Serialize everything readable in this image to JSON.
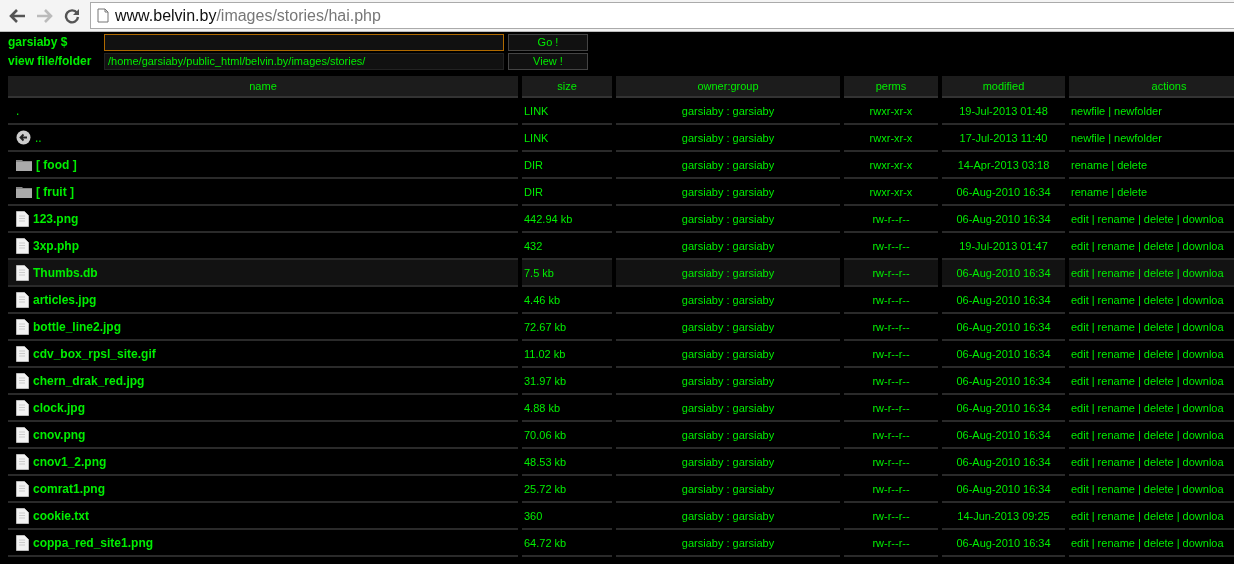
{
  "browser": {
    "url_host": "www.belvin.by",
    "url_path": "/images/stories/hai.php"
  },
  "command": {
    "label": "garsiaby $",
    "button": "Go !"
  },
  "view": {
    "label": "view file/folder",
    "value": "/home/garsiaby/public_html/belvin.by/images/stories/",
    "button": "View !"
  },
  "table": {
    "columns": [
      "name",
      "size",
      "owner:group",
      "perms",
      "modified",
      "actions"
    ],
    "separator": "|",
    "rows": [
      {
        "kind": "link",
        "name": ".",
        "size": "LINK",
        "owner": "garsiaby : garsiaby",
        "perms": "rwxr-xr-x",
        "modified": "19-Jul-2013 01:48",
        "actions": [
          "newfile",
          "newfolder"
        ],
        "selected": false
      },
      {
        "kind": "up",
        "name": "..",
        "size": "LINK",
        "owner": "garsiaby : garsiaby",
        "perms": "rwxr-xr-x",
        "modified": "17-Jul-2013 11:40",
        "actions": [
          "newfile",
          "newfolder"
        ],
        "selected": false
      },
      {
        "kind": "dir",
        "name": "[ food ]",
        "size": "DIR",
        "owner": "garsiaby : garsiaby",
        "perms": "rwxr-xr-x",
        "modified": "14-Apr-2013 03:18",
        "actions": [
          "rename",
          "delete"
        ],
        "selected": false
      },
      {
        "kind": "dir",
        "name": "[ fruit ]",
        "size": "DIR",
        "owner": "garsiaby : garsiaby",
        "perms": "rwxr-xr-x",
        "modified": "06-Aug-2010 16:34",
        "actions": [
          "rename",
          "delete"
        ],
        "selected": false
      },
      {
        "kind": "file",
        "name": "123.png",
        "size": "442.94 kb",
        "owner": "garsiaby : garsiaby",
        "perms": "rw-r--r--",
        "modified": "06-Aug-2010 16:34",
        "actions": [
          "edit",
          "rename",
          "delete",
          "downloa"
        ],
        "selected": false
      },
      {
        "kind": "file",
        "name": "3xp.php",
        "size": "432",
        "owner": "garsiaby : garsiaby",
        "perms": "rw-r--r--",
        "modified": "19-Jul-2013 01:47",
        "actions": [
          "edit",
          "rename",
          "delete",
          "downloa"
        ],
        "selected": false
      },
      {
        "kind": "file",
        "name": "Thumbs.db",
        "size": "7.5 kb",
        "owner": "garsiaby : garsiaby",
        "perms": "rw-r--r--",
        "modified": "06-Aug-2010 16:34",
        "actions": [
          "edit",
          "rename",
          "delete",
          "downloa"
        ],
        "selected": true
      },
      {
        "kind": "file",
        "name": "articles.jpg",
        "size": "4.46 kb",
        "owner": "garsiaby : garsiaby",
        "perms": "rw-r--r--",
        "modified": "06-Aug-2010 16:34",
        "actions": [
          "edit",
          "rename",
          "delete",
          "downloa"
        ],
        "selected": false
      },
      {
        "kind": "file",
        "name": "bottle_line2.jpg",
        "size": "72.67 kb",
        "owner": "garsiaby : garsiaby",
        "perms": "rw-r--r--",
        "modified": "06-Aug-2010 16:34",
        "actions": [
          "edit",
          "rename",
          "delete",
          "downloa"
        ],
        "selected": false
      },
      {
        "kind": "file",
        "name": "cdv_box_rpsl_site.gif",
        "size": "11.02 kb",
        "owner": "garsiaby : garsiaby",
        "perms": "rw-r--r--",
        "modified": "06-Aug-2010 16:34",
        "actions": [
          "edit",
          "rename",
          "delete",
          "downloa"
        ],
        "selected": false
      },
      {
        "kind": "file",
        "name": "chern_drak_red.jpg",
        "size": "31.97 kb",
        "owner": "garsiaby : garsiaby",
        "perms": "rw-r--r--",
        "modified": "06-Aug-2010 16:34",
        "actions": [
          "edit",
          "rename",
          "delete",
          "downloa"
        ],
        "selected": false
      },
      {
        "kind": "file",
        "name": "clock.jpg",
        "size": "4.88 kb",
        "owner": "garsiaby : garsiaby",
        "perms": "rw-r--r--",
        "modified": "06-Aug-2010 16:34",
        "actions": [
          "edit",
          "rename",
          "delete",
          "downloa"
        ],
        "selected": false
      },
      {
        "kind": "file",
        "name": "cnov.png",
        "size": "70.06 kb",
        "owner": "garsiaby : garsiaby",
        "perms": "rw-r--r--",
        "modified": "06-Aug-2010 16:34",
        "actions": [
          "edit",
          "rename",
          "delete",
          "downloa"
        ],
        "selected": false
      },
      {
        "kind": "file",
        "name": "cnov1_2.png",
        "size": "48.53 kb",
        "owner": "garsiaby : garsiaby",
        "perms": "rw-r--r--",
        "modified": "06-Aug-2010 16:34",
        "actions": [
          "edit",
          "rename",
          "delete",
          "downloa"
        ],
        "selected": false
      },
      {
        "kind": "file",
        "name": "comrat1.png",
        "size": "25.72 kb",
        "owner": "garsiaby : garsiaby",
        "perms": "rw-r--r--",
        "modified": "06-Aug-2010 16:34",
        "actions": [
          "edit",
          "rename",
          "delete",
          "downloa"
        ],
        "selected": false
      },
      {
        "kind": "file",
        "name": "cookie.txt",
        "size": "360",
        "owner": "garsiaby : garsiaby",
        "perms": "rw-r--r--",
        "modified": "14-Jun-2013 09:25",
        "actions": [
          "edit",
          "rename",
          "delete",
          "downloa"
        ],
        "selected": false
      },
      {
        "kind": "file",
        "name": "coppa_red_site1.png",
        "size": "64.72 kb",
        "owner": "garsiaby : garsiaby",
        "perms": "rw-r--r--",
        "modified": "06-Aug-2010 16:34",
        "actions": [
          "edit",
          "rename",
          "delete",
          "downloa"
        ],
        "selected": false
      }
    ]
  }
}
